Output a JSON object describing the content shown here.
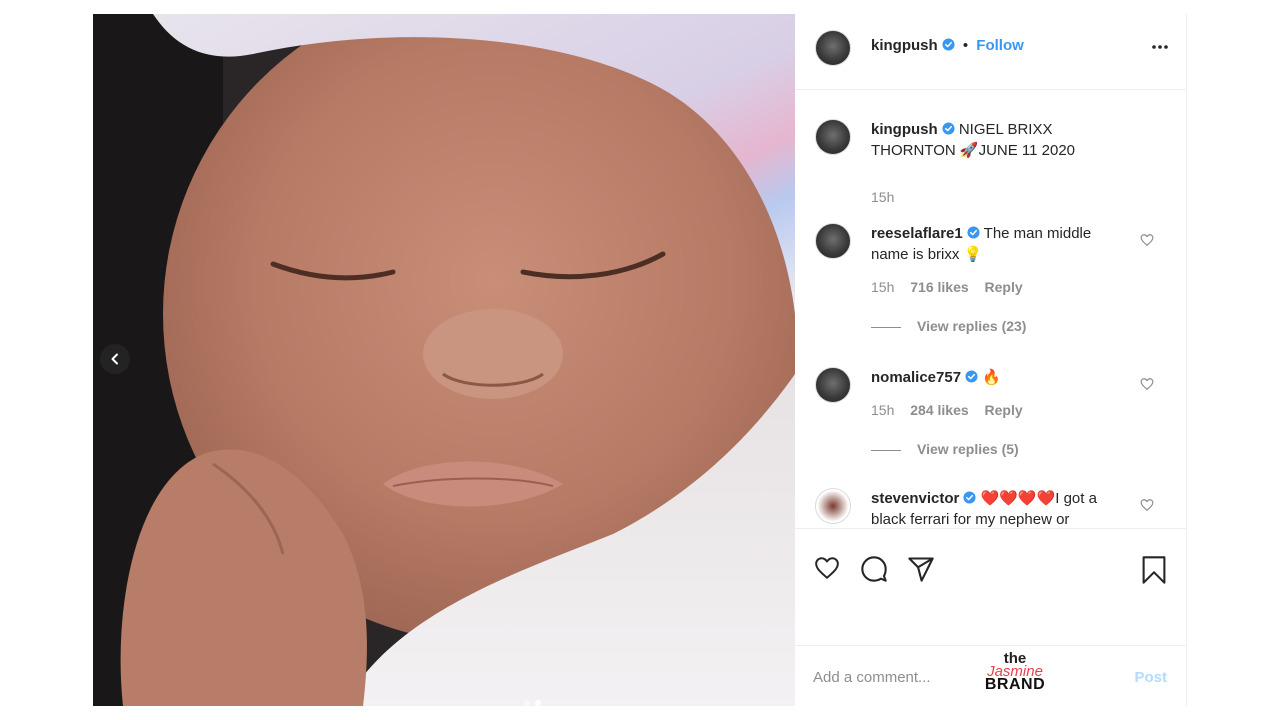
{
  "post": {
    "author": "kingpush",
    "follow_label": "Follow",
    "separator": "•",
    "carousel": {
      "total_slides": 2,
      "active_slide": 2
    }
  },
  "comments": [
    {
      "username": "kingpush",
      "text": "NIGEL BRIXX THORNTON 🚀JUNE 11 2020",
      "time": "15h"
    },
    {
      "username": "reeselaflare1",
      "text": "The man middle name is brixx 💡",
      "time": "15h",
      "likes": "716 likes",
      "reply_label": "Reply",
      "view_replies": "View replies (23)"
    },
    {
      "username": "nomalice757",
      "text": "🔥",
      "time": "15h",
      "likes": "284 likes",
      "reply_label": "Reply",
      "view_replies": "View replies (5)"
    },
    {
      "username": "stevenvictor",
      "text": "❤️❤️❤️❤️I got a black ferrari for my nephew or"
    }
  ],
  "composer": {
    "placeholder": "Add a comment...",
    "post_label": "Post"
  },
  "watermark": {
    "line1": "the",
    "line2": "Jasmine",
    "line3": "BRAND"
  },
  "icons": {
    "verified": "verified-badge-icon",
    "more": "more-options-icon",
    "like": "heart-icon",
    "comment": "comment-icon",
    "share": "share-icon",
    "save": "bookmark-icon",
    "prev": "chevron-left-icon"
  },
  "colors": {
    "accent": "#3897f0",
    "post_disabled": "#b3dbff",
    "muted": "#8e8e8e",
    "text": "#262626"
  }
}
